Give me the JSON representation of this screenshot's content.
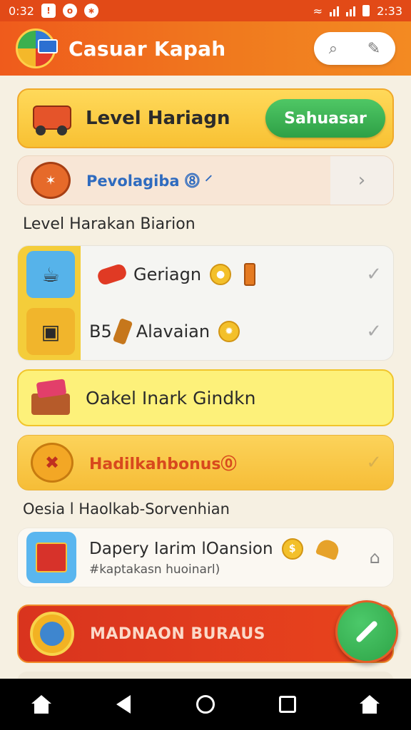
{
  "status_bar": {
    "time_left": "0:32",
    "time_right": "2:33",
    "icons": [
      "alert-icon",
      "circle-icon",
      "bluetooth-icon",
      "wifi-icon",
      "signal-icon",
      "battery-icon"
    ]
  },
  "header": {
    "title": "Casuar Kapah",
    "actions": [
      "search-icon",
      "edit-icon"
    ]
  },
  "level_card": {
    "title": "Level Hariagn",
    "button_label": "Sahuasar"
  },
  "promo": {
    "text": "Pevolagiba ⓼ ⸍",
    "chevron": "›"
  },
  "section1": {
    "label": "Level Harakan Biarion"
  },
  "list": {
    "items": [
      {
        "text": "Geriagn",
        "coin": "●"
      },
      {
        "text": "Alavaian",
        "prefix": "B5",
        "coin": "✹"
      }
    ]
  },
  "yellow_card": {
    "title": "Oakel Inark Gindkn"
  },
  "orange_card": {
    "title": "Hadilkahbonus⓪"
  },
  "section2": {
    "label": "Oesia l Haolkab-Sorvenhian"
  },
  "product": {
    "title": "Dapery  Iarim lOansion",
    "subtitle": "#kaptakasn huoinarl)",
    "coin": "$"
  },
  "bonus_banner": {
    "title": "MADNAON BURAUS"
  },
  "colors": {
    "brand_orange": "#ef5b1c",
    "accent_green": "#2ea046",
    "banner_red": "#d9341e",
    "card_yellow": "#fdf17a"
  },
  "nav": {
    "buttons": [
      "home-icon",
      "back-icon",
      "home-circle-icon",
      "recents-icon",
      "profile-icon"
    ]
  }
}
